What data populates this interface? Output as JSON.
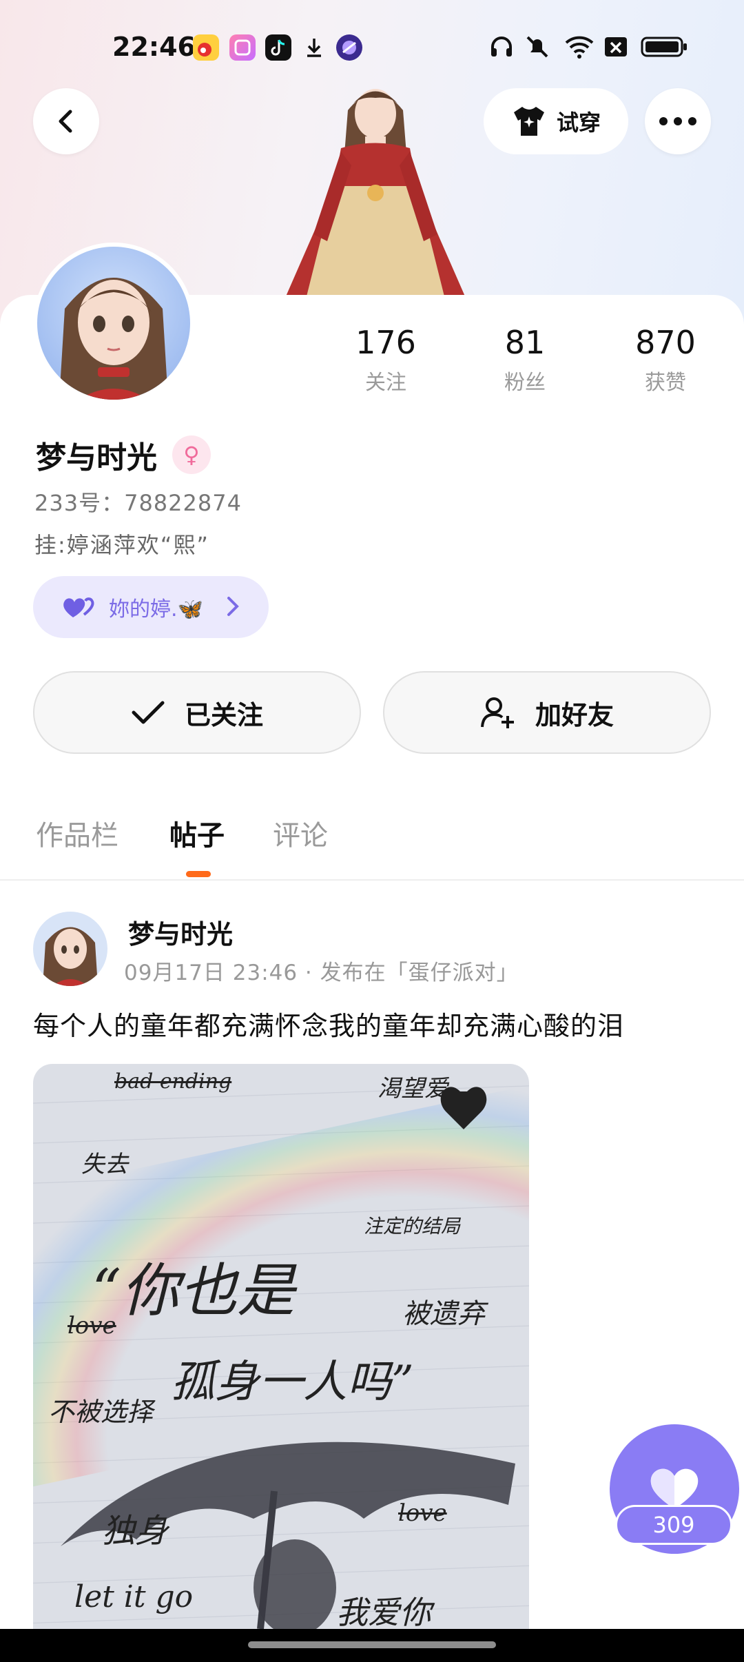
{
  "status_bar": {
    "time": "22:46",
    "apps": [
      "weibo-icon",
      "photo-app-icon",
      "tiktok-icon",
      "download-icon",
      "browser-icon"
    ],
    "right_icons": [
      "headphones-icon",
      "mute-icon",
      "wifi-icon",
      "sim-off-icon",
      "battery-icon"
    ]
  },
  "header": {
    "try_on_label": "试穿"
  },
  "profile": {
    "name": "梦与时光",
    "gender_symbol": "♀",
    "id_line": "233号：78822874",
    "signature": "挂:婷涵萍欢“熙”",
    "cp_label": "妳的婷.🦋",
    "stats": [
      {
        "num": "176",
        "label": "关注"
      },
      {
        "num": "81",
        "label": "粉丝"
      },
      {
        "num": "870",
        "label": "获赞"
      }
    ],
    "followed_label": "已关注",
    "add_friend_label": "加好友"
  },
  "tabs": [
    {
      "label": "作品栏"
    },
    {
      "label": "帖子"
    },
    {
      "label": "评论"
    }
  ],
  "post": {
    "author": "梦与时光",
    "meta": "09月17日 23:46 · 发布在「蛋仔派对」",
    "text": "每个人的童年都充满怀念我的童年却充满心酸的泪",
    "image_words": {
      "w1": "bad ending",
      "w2": "渴望爱",
      "w3": "失去",
      "w4": "注定的结局",
      "w5": "“你也是",
      "w6": "被遗弃",
      "w7": "love",
      "w8": "孤身一人吗”",
      "w9": "不被选择",
      "w10": "独身",
      "w11": "love",
      "w12": "let it go",
      "w13": "我爱你"
    }
  },
  "like": {
    "count": "309"
  },
  "colors": {
    "accent_orange": "#ff6a1a",
    "like_purple": "#8a7cf4",
    "chip_bg": "#ebe9fd",
    "chip_text": "#7b6be6"
  }
}
